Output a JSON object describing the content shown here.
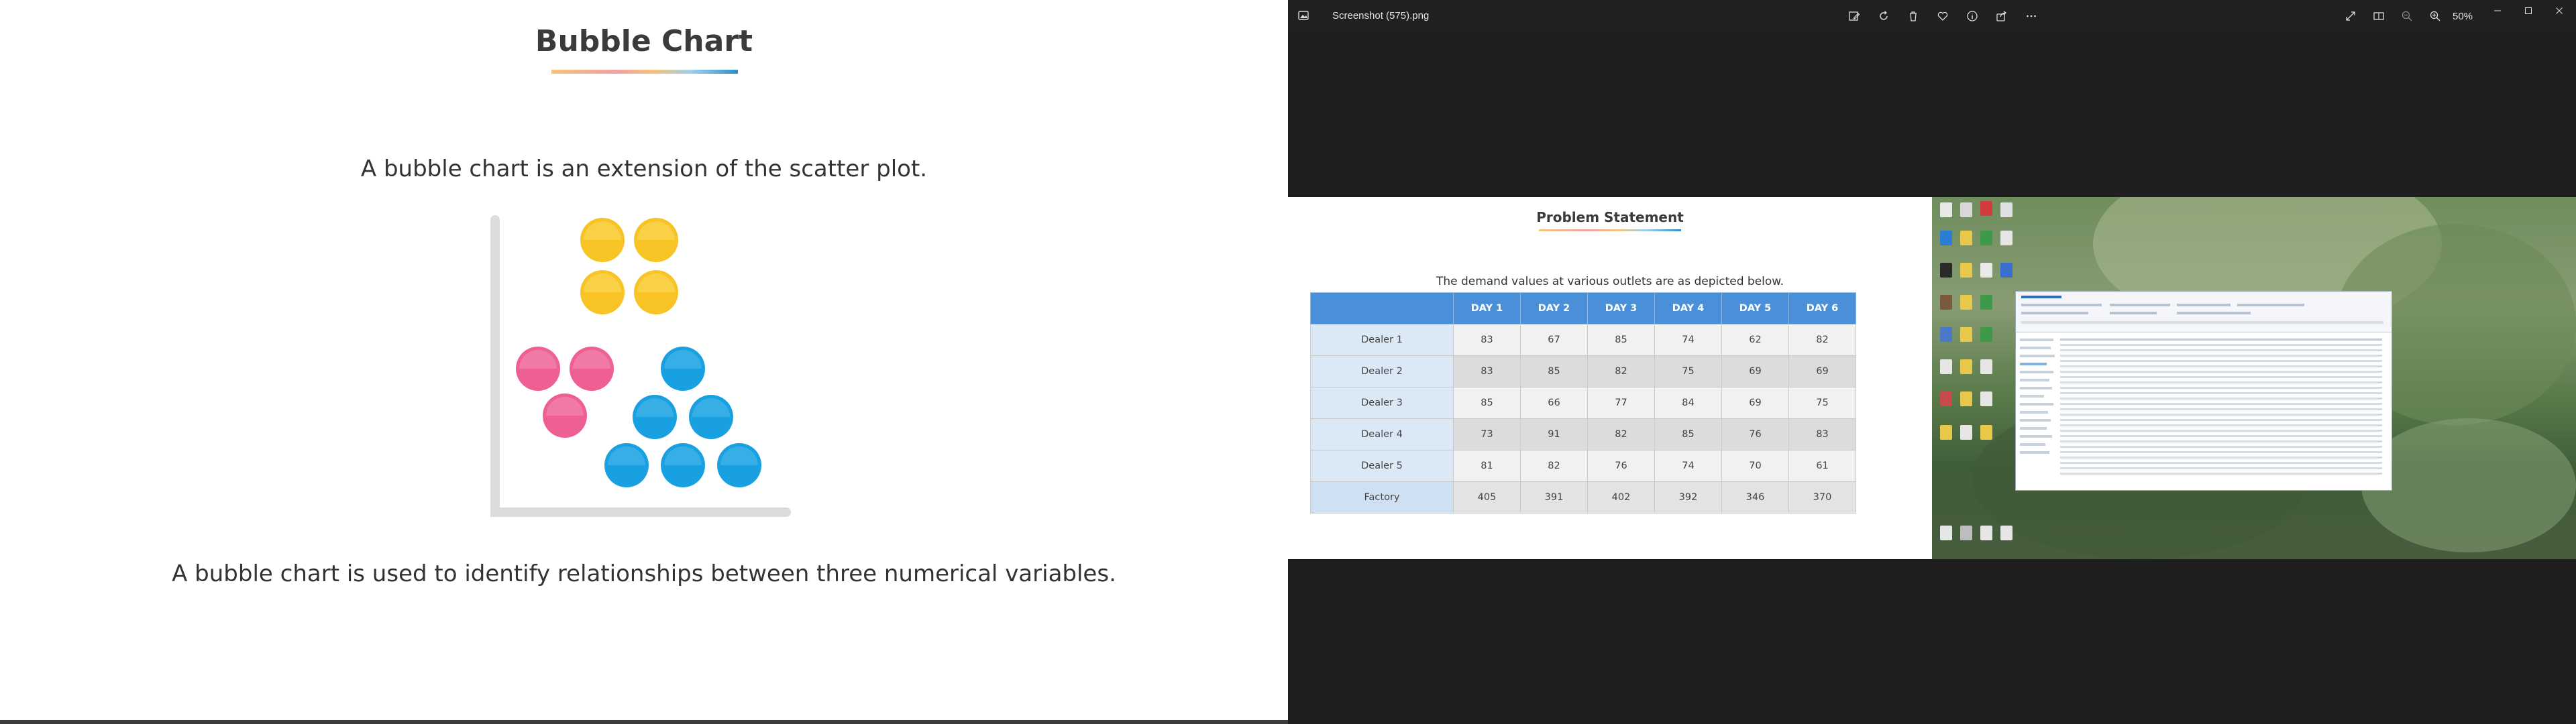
{
  "slide": {
    "title": "Bubble Chart",
    "intro": "A bubble chart is an extension of the scatter plot.",
    "usage": "A bubble chart is used to identify relationships between three numerical variables."
  },
  "viewer": {
    "window_title": "Screenshot (575).png",
    "zoom": "50%",
    "toolbar_icons": [
      "edit-icon",
      "rotate-icon",
      "delete-icon",
      "favorite-icon",
      "info-icon",
      "share-icon",
      "more-icon"
    ],
    "right_icons": [
      "fullscreen-icon",
      "compare-icon",
      "zoom-out-icon",
      "zoom-in-icon"
    ],
    "window_controls": [
      "minimize-icon",
      "maximize-icon",
      "close-icon"
    ]
  },
  "inner_slide": {
    "title": "Problem Statement",
    "description": "The demand values at various outlets are as depicted below.",
    "table": {
      "headers": [
        "DAY 1",
        "DAY 2",
        "DAY 3",
        "DAY 4",
        "DAY 5",
        "DAY 6"
      ],
      "rows": [
        {
          "label": "Dealer 1",
          "values": [
            "83",
            "67",
            "85",
            "74",
            "62",
            "82"
          ]
        },
        {
          "label": "Dealer 2",
          "values": [
            "83",
            "85",
            "82",
            "75",
            "69",
            "69"
          ]
        },
        {
          "label": "Dealer 3",
          "values": [
            "85",
            "66",
            "77",
            "84",
            "69",
            "75"
          ]
        },
        {
          "label": "Dealer 4",
          "values": [
            "73",
            "91",
            "82",
            "85",
            "76",
            "83"
          ]
        },
        {
          "label": "Dealer 5",
          "values": [
            "81",
            "82",
            "76",
            "74",
            "70",
            "61"
          ]
        },
        {
          "label": "Factory",
          "values": [
            "405",
            "391",
            "402",
            "392",
            "346",
            "370"
          ]
        }
      ]
    }
  },
  "colors": {
    "yellow_bubble": "#f7c325",
    "pink_bubble": "#ee5f93",
    "blue_bubble": "#18a0e0",
    "table_header": "#4a90d9",
    "viewer_bg": "#1f1f1f"
  }
}
